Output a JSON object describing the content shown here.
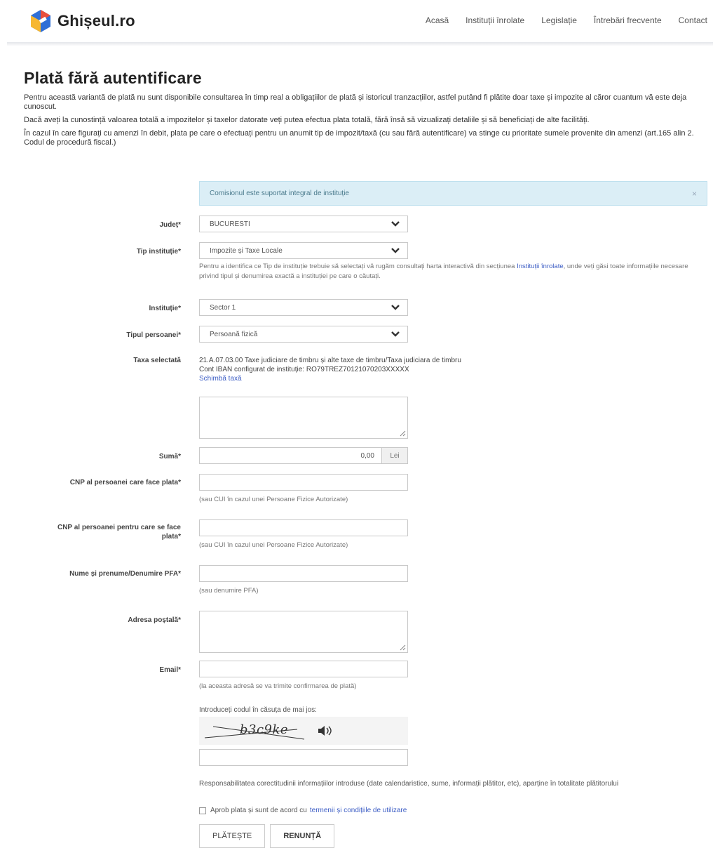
{
  "header": {
    "logo_text": "Ghișeul.ro",
    "nav": [
      "Acasă",
      "Instituții înrolate",
      "Legislație",
      "Întrebări frecvente",
      "Contact"
    ]
  },
  "page": {
    "title": "Plată fără autentificare",
    "intro": [
      "Pentru această variantă de plată nu sunt disponibile consultarea în timp real a obligațiilor de plată și istoricul tranzacțiilor, astfel putând fi plătite doar taxe și impozite al căror cuantum vă este deja cunoscut.",
      "Dacă aveți la cunostință valoarea totală a impozitelor și taxelor datorate veți putea efectua plata totală, fără însă să vizualizați detaliile și să beneficiați de alte facilități.",
      "În cazul în care figurați cu amenzi în debit, plata pe care o efectuați pentru un anumit tip de impozit/taxă (cu sau fără autentificare) va stinge cu prioritate sumele provenite din amenzi (art.165 alin 2. Codul de procedură fiscal.)"
    ]
  },
  "alert": {
    "text": "Comisionul este suportat integral de instituție",
    "close": "×"
  },
  "form": {
    "judet": {
      "label": "Județ*",
      "value": "BUCURESTI"
    },
    "tip_institutie": {
      "label": "Tip instituție*",
      "value": "Impozite și Taxe Locale",
      "hint_before": "Pentru a identifica ce Tip de instituție trebuie să selectați vă rugăm consultați harta interactivă din secțiunea ",
      "hint_link": "Instituții înrolate",
      "hint_after": ", unde veți găsi toate informațiile necesare privind tipul și denumirea exactă a instituției pe care o căutați."
    },
    "institutie": {
      "label": "Instituție*",
      "value": "Sector 1"
    },
    "tipul_persoanei": {
      "label": "Tipul persoanei*",
      "value": "Persoană fizică"
    },
    "taxa": {
      "label": "Taxa selectată",
      "line1": "21.A.07.03.00 Taxe judiciare de timbru și alte taxe de timbru/Taxa judiciara de timbru",
      "line2": "Cont IBAN configurat de instituție: RO79TREZ70121070203XXXXX",
      "change_link": "Schimbă taxă"
    },
    "suma": {
      "label": "Sumă*",
      "value": "0,00",
      "currency": "Lei"
    },
    "cnp_platitor": {
      "label": "CNP al persoanei care face plata*",
      "hint": "(sau CUI în cazul unei Persoane Fizice Autorizate)"
    },
    "cnp_beneficiar": {
      "label_line1": "CNP al persoanei pentru care se face",
      "label_line2": "plata*",
      "hint": "(sau CUI în cazul unei Persoane Fizice Autorizate)"
    },
    "nume": {
      "label": "Nume și prenume/Denumire PFA*",
      "hint": "(sau denumire PFA)"
    },
    "adresa": {
      "label": "Adresa poștală*"
    },
    "email": {
      "label": "Email*",
      "hint": "(la aceasta adresă se va trimite confirmarea de plată)"
    },
    "captcha": {
      "label": "Introduceți codul în căsuța de mai jos:",
      "code": "b3c9ke"
    },
    "responsibility": "Responsabilitatea corectitudinii informațiilor introduse (date calendaristice, sume, informații plătitor, etc), aparține în totalitate plătitorului",
    "agree_text": "Aprob plata și sunt de acord cu",
    "agree_link": "termenii și condițiile de utilizare",
    "pay_button": "PLĂTEȘTE",
    "cancel_button": "RENUNȚĂ"
  },
  "colors": {
    "link": "#3b5cc4",
    "alert_bg": "#dbeef6"
  }
}
